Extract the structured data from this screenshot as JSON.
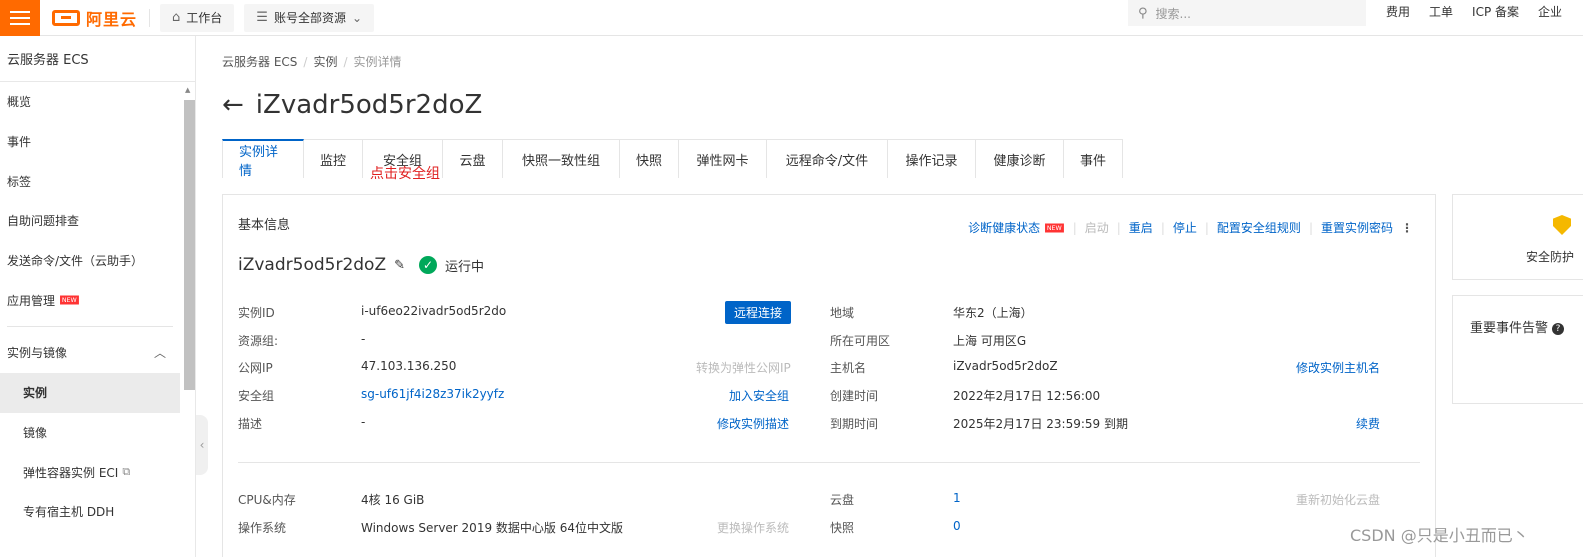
{
  "topbar": {
    "logo_text": "阿里云",
    "workbench": "工作台",
    "resource_scope": "账号全部资源",
    "search_placeholder": "搜索...",
    "links": [
      "费用",
      "工单",
      "ICP 备案",
      "企业"
    ]
  },
  "sidebar": {
    "title": "云服务器 ECS",
    "items": [
      {
        "label": "概览"
      },
      {
        "label": "事件"
      },
      {
        "label": "标签"
      },
      {
        "label": "自助问题排查"
      },
      {
        "label": "发送命令/文件（云助手）"
      },
      {
        "label": "应用管理",
        "badge": "NEW"
      }
    ],
    "group": "实例与镜像",
    "sub_items": [
      {
        "label": "实例",
        "active": true
      },
      {
        "label": "镜像"
      },
      {
        "label": "弹性容器实例 ECI"
      },
      {
        "label": "专有宿主机 DDH"
      }
    ]
  },
  "breadcrumb": [
    "云服务器 ECS",
    "实例",
    "实例详情"
  ],
  "page_title": "iZvadr5od5r2doZ",
  "tabs": [
    "实例详情",
    "监控",
    "安全组",
    "云盘",
    "快照一致性组",
    "快照",
    "弹性网卡",
    "远程命令/文件",
    "操作记录",
    "健康诊断",
    "事件"
  ],
  "annotation": "点击安全组",
  "basic_info": {
    "title": "基本信息",
    "actions": {
      "diagnose": "诊断健康状态",
      "diagnose_badge": "NEW",
      "start": "启动",
      "restart": "重启",
      "stop": "停止",
      "config_sg": "配置安全组规则",
      "reset_pwd": "重置实例密码"
    },
    "instance_name": "iZvadr5od5r2doZ",
    "status": "运行中",
    "remote_connect": "远程连接",
    "left": {
      "instance_id_label": "实例ID",
      "instance_id": "i-uf6eo22ivadr5od5r2do",
      "resource_group_label": "资源组:",
      "resource_group": "-",
      "public_ip_label": "公网IP",
      "public_ip": "47.103.136.250",
      "public_ip_action": "转换为弹性公网IP",
      "sg_label": "安全组",
      "sg": "sg-uf61jf4i28z37ik2yyfz",
      "sg_action": "加入安全组",
      "desc_label": "描述",
      "desc": "-",
      "desc_action": "修改实例描述"
    },
    "right": {
      "region_label": "地域",
      "region": "华东2（上海）",
      "zone_label": "所在可用区",
      "zone": "上海 可用区G",
      "host_label": "主机名",
      "host": "iZvadr5od5r2doZ",
      "host_action": "修改实例主机名",
      "created_label": "创建时间",
      "created": "2022年2月17日 12:56:00",
      "expire_label": "到期时间",
      "expire": "2025年2月17日 23:59:59 到期",
      "expire_action": "续费"
    },
    "specs": {
      "cpu_label": "CPU&内存",
      "cpu": "4核 16 GiB",
      "os_label": "操作系统",
      "os": "Windows Server 2019 数据中心版 64位中文版",
      "os_action": "更换操作系统",
      "disk_label": "云盘",
      "disk": "1",
      "disk_action": "重新初始化云盘",
      "snapshot_label": "快照",
      "snapshot": "0"
    }
  },
  "right_panel": {
    "security_label": "安全防护",
    "events_label": "重要事件告警"
  },
  "watermark": "CSDN @只是小丑而已丶"
}
